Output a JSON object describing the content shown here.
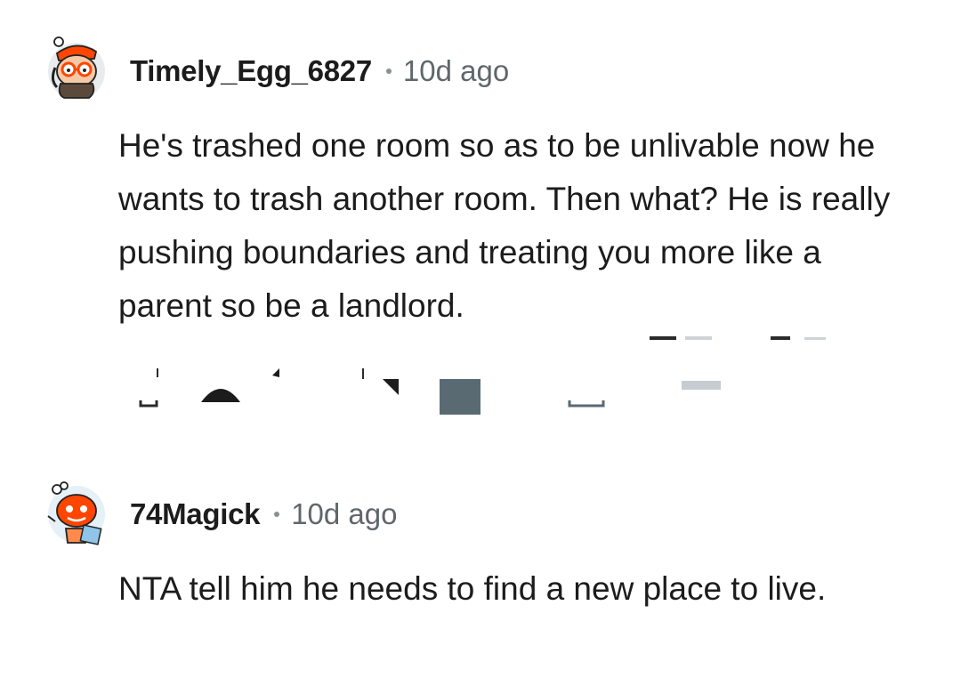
{
  "comments": [
    {
      "username": "Timely_Egg_6827",
      "time": "10d ago",
      "avatar_icon": "snoo-avatar-glasses-icon",
      "text": "He's trashed one room so as to be unlivable now he wants to trash another room. Then what? He is really pushing boundaries and treating you more like a parent so be a landlord."
    },
    {
      "username": "74Magick",
      "time": "10d ago",
      "avatar_icon": "snoo-avatar-red-icon",
      "text": "NTA tell him he needs to find a new place to live."
    }
  ],
  "colors": {
    "text": "#1c1c1c",
    "meta": "#5f676b",
    "background": "#ffffff"
  }
}
